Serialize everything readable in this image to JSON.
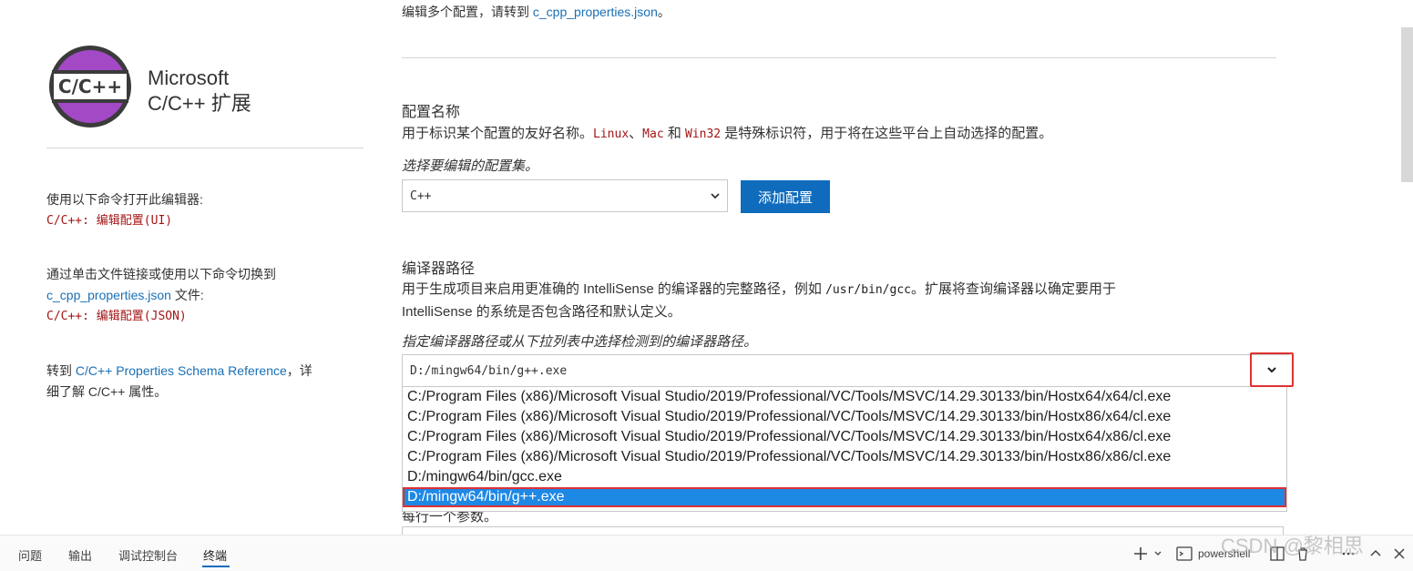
{
  "left": {
    "logo_text": "C/C++",
    "title_line1": "Microsoft",
    "title_line2": "C/C++ 扩展",
    "open_editor_label": "使用以下命令打开此编辑器:",
    "open_editor_cmd": "C/C++: 编辑配置(UI)",
    "switch_label": "通过单击文件链接或使用以下命令切换到",
    "switch_link": "c_cpp_properties.json",
    "switch_suffix": " 文件:",
    "switch_cmd": "C/C++: 编辑配置(JSON)",
    "schema_prefix": "转到 ",
    "schema_link": "C/C++ Properties Schema Reference",
    "schema_suffix": "，详",
    "schema_line2": "细了解 C/C++ 属性。"
  },
  "top_line": {
    "prefix": "编辑多个配置，请转到 ",
    "link": "c_cpp_properties.json",
    "suffix": "。"
  },
  "config_name": {
    "title": "配置名称",
    "desc_prefix": "用于标识某个配置的友好名称。",
    "code1": "Linux",
    "sep1": "、",
    "code2": "Mac",
    "and": " 和 ",
    "code3": "Win32",
    "desc_suffix": " 是特殊标识符，用于将在这些平台上自动选择的配置。",
    "hint": "选择要编辑的配置集。",
    "selected": "C++",
    "add_button": "添加配置"
  },
  "compiler_path": {
    "title": "编译器路径",
    "desc1_prefix": "用于生成项目来启用更准确的 IntelliSense 的编译器的完整路径，例如 ",
    "desc1_code": "/usr/bin/gcc",
    "desc1_suffix": "。扩展将查询编译器以确定要用于",
    "desc2": "IntelliSense 的系统是否包含路径和默认定义。",
    "hint": "指定编译器路径或从下拉列表中选择检测到的编译器路径。",
    "value": "D:/mingw64/bin/g++.exe",
    "options": [
      "C:/Program Files (x86)/Microsoft Visual Studio/2019/Professional/VC/Tools/MSVC/14.29.30133/bin/Hostx64/x64/cl.exe",
      "C:/Program Files (x86)/Microsoft Visual Studio/2019/Professional/VC/Tools/MSVC/14.29.30133/bin/Hostx86/x64/cl.exe",
      "C:/Program Files (x86)/Microsoft Visual Studio/2019/Professional/VC/Tools/MSVC/14.29.30133/bin/Hostx64/x86/cl.exe",
      "C:/Program Files (x86)/Microsoft Visual Studio/2019/Professional/VC/Tools/MSVC/14.29.30133/bin/Hostx86/x86/cl.exe",
      "D:/mingw64/bin/gcc.exe",
      "D:/mingw64/bin/g++.exe"
    ],
    "behind_text": "每行一个参数。"
  },
  "panel": {
    "tabs": [
      "问题",
      "输出",
      "调试控制台",
      "终端"
    ],
    "active_tab": "终端",
    "shell_label": "powershell"
  },
  "watermark": "CSDN @黎相思",
  "colors": {
    "accent": "#0f6cbd",
    "highlight": "#1e88e5",
    "annotation_red": "#e03131",
    "code_red": "#a31515",
    "link": "#1a6fb4"
  }
}
